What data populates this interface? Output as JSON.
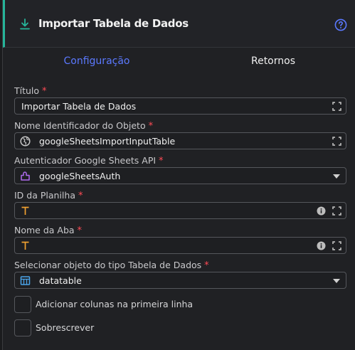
{
  "header": {
    "title": "Importar Tabela de Dados",
    "icon": "download-icon",
    "help_icon": "help-circle-icon"
  },
  "tabs": [
    {
      "label": "Configuração",
      "active": true
    },
    {
      "label": "Retornos",
      "active": false
    }
  ],
  "fields": {
    "titulo": {
      "label": "Título",
      "required": "*",
      "value": "Importar Tabela de Dados"
    },
    "nome_identificador": {
      "label": "Nome Identificador do Objeto",
      "required": "*",
      "value": "googleSheetsImportInputTable",
      "icon": "globe-icon"
    },
    "autenticador": {
      "label": "Autenticador Google Sheets API",
      "required": "*",
      "value": "googleSheetsAuth",
      "icon": "connector-icon"
    },
    "id_planilha": {
      "label": "ID da Planilha",
      "required": "*",
      "value": "",
      "icon": "text-type-icon"
    },
    "nome_aba": {
      "label": "Nome da Aba",
      "required": "*",
      "value": "",
      "icon": "text-type-icon"
    },
    "objeto_tabela": {
      "label": "Selecionar objeto do tipo Tabela de Dados",
      "required": "*",
      "value": "datatable",
      "icon": "table-icon"
    }
  },
  "checkboxes": [
    {
      "label": "Adicionar colunas na primeira linha",
      "checked": false
    },
    {
      "label": "Sobrescrever",
      "checked": false
    }
  ],
  "colors": {
    "accent": "#26b59a",
    "tab_active": "#5b79ff",
    "required": "#ff4b55",
    "type_icon": "#f0a030",
    "connector_icon": "#b06cf0",
    "table_icon": "#4aa3e8"
  }
}
